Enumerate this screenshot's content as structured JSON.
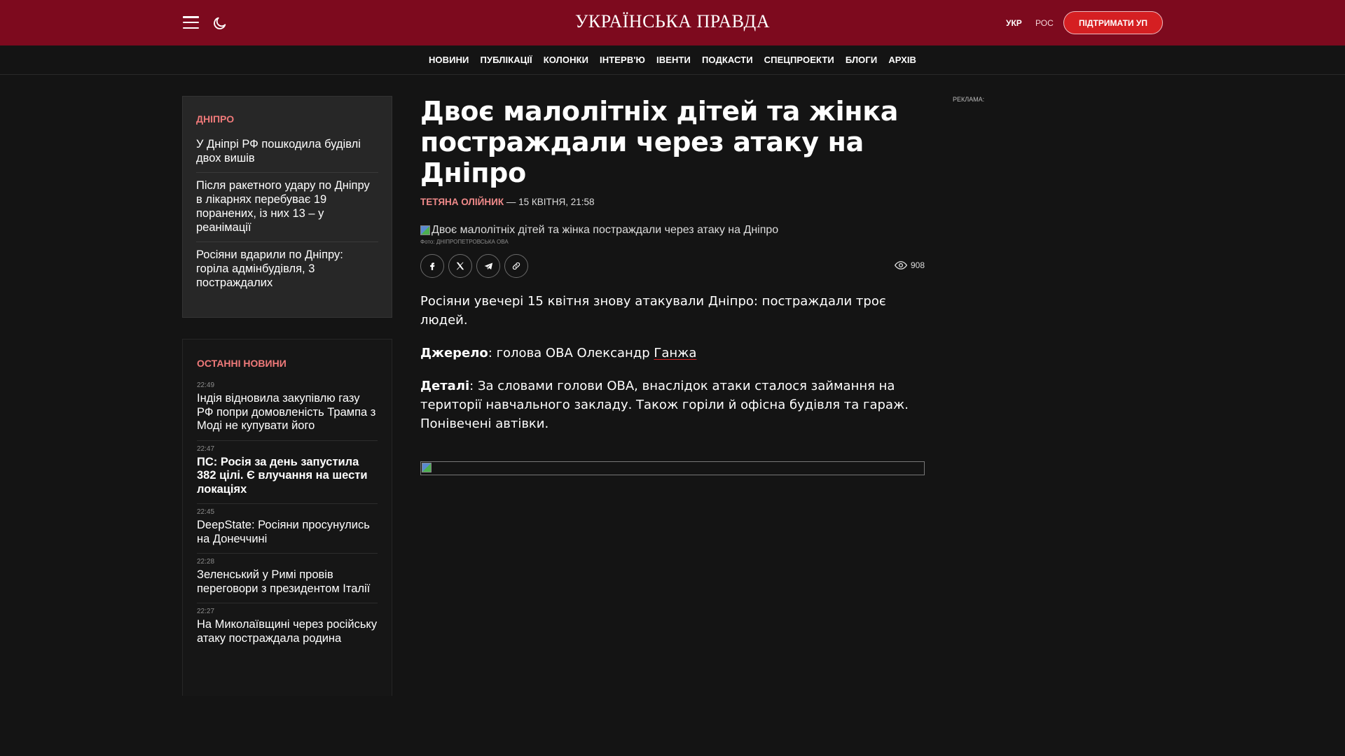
{
  "header": {
    "logo": "УКРАЇНСЬКА ПРАВДА",
    "lang_ukr": "УКР",
    "lang_ros": "РОС",
    "support_label": "ПІДТРИМАТИ УП",
    "bg_color": "#7d0a1e"
  },
  "nav": {
    "items": [
      "НОВИНИ",
      "ПУБЛІКАЦІЇ",
      "КОЛОНКИ",
      "ІНТЕРВ'Ю",
      "ІВЕНТИ",
      "ПОДКАСТИ",
      "СПЕЦПРОЕКТИ",
      "БЛОГИ",
      "АРХІВ"
    ]
  },
  "sidebar": {
    "related": {
      "heading": "ДНІПРО",
      "items": [
        "У Дніпрі РФ пошкодила будівлі двох вишів",
        "Після ракетного удару по Дніпру в лікарнях перебуває 19 поранених, із них 13 – у реанімації",
        "Росіяни вдарили по Дніпру: горіла адмінбудівля, 3 постраждалих"
      ]
    },
    "latest": {
      "heading": "ОСТАННІ НОВИНИ",
      "items": [
        {
          "time": "22:49",
          "title": "Індія відновила закупівлю газу РФ попри домовленість Трампа з Моді не купувати його",
          "bold": false
        },
        {
          "time": "22:47",
          "title": "ПС: Росія за день запустила 382 цілі. Є влучання на шести локаціях",
          "bold": true
        },
        {
          "time": "22:45",
          "title": "DeepState: Росіяни просунулись на Донеччині",
          "bold": false
        },
        {
          "time": "22:28",
          "title": "Зеленський у Римі провів переговори з президентом Італії",
          "bold": false
        },
        {
          "time": "22:27",
          "title": "На Миколаївщині через російську атаку постраждала родина",
          "bold": false
        }
      ]
    }
  },
  "article": {
    "title": "Двоє малолітніх дітей та жінка постраждали через атаку на Дніпро",
    "author": "ТЕТЯНА ОЛІЙНИК",
    "date": "— 15 КВІТНЯ, 21:58",
    "image_alt": "Двоє малолітніх дітей та жінка постраждали через атаку на Дніпро",
    "image_caption": "Фото: ДНІПРОПЕТРОВСЬКА ОВА",
    "views": "908",
    "p1": "Росіяни увечері 15 квітня знову атакували Дніпро: постраждали троє людей.",
    "p2_label": "Джерело",
    "p2_text": ": голова ОВА Олександр ",
    "p2_link": "Ганжа",
    "p3_label": "Деталі",
    "p3_text": ": За словами голови ОВА, внаслідок атаки сталося займання на території навчального закладу. Також горіли й офісна будівля та гараж. Понівечені автівки."
  },
  "ad": {
    "label": "РЕКЛАМА:"
  }
}
